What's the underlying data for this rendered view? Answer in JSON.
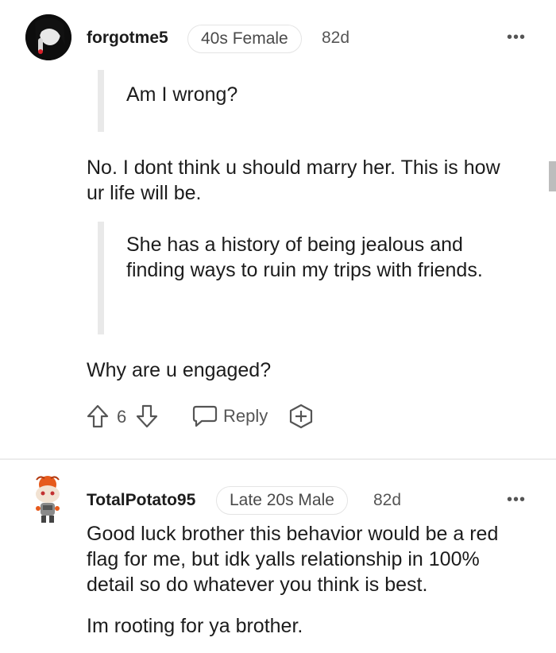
{
  "comment1": {
    "username": "forgotme5",
    "flair": "40s Female",
    "age": "82d",
    "more": "•••",
    "quote1": "Am I wrong?",
    "reply1": "No. I dont think u should marry her. This is how ur life will be.",
    "quote2": "She has a history of being jealous and finding ways to ruin my trips with friends.",
    "reply2": "Why are u engaged?",
    "votes": "6",
    "reply_label": "Reply"
  },
  "comment2": {
    "username": "TotalPotato95",
    "flair": "Late 20s Male",
    "age": "82d",
    "more": "•••",
    "para1": "Good luck brother this behavior would be a red flag for me, but idk yalls relationship in 100% detail so do whatever you think is best.",
    "para2": "Im rooting for ya brother."
  }
}
